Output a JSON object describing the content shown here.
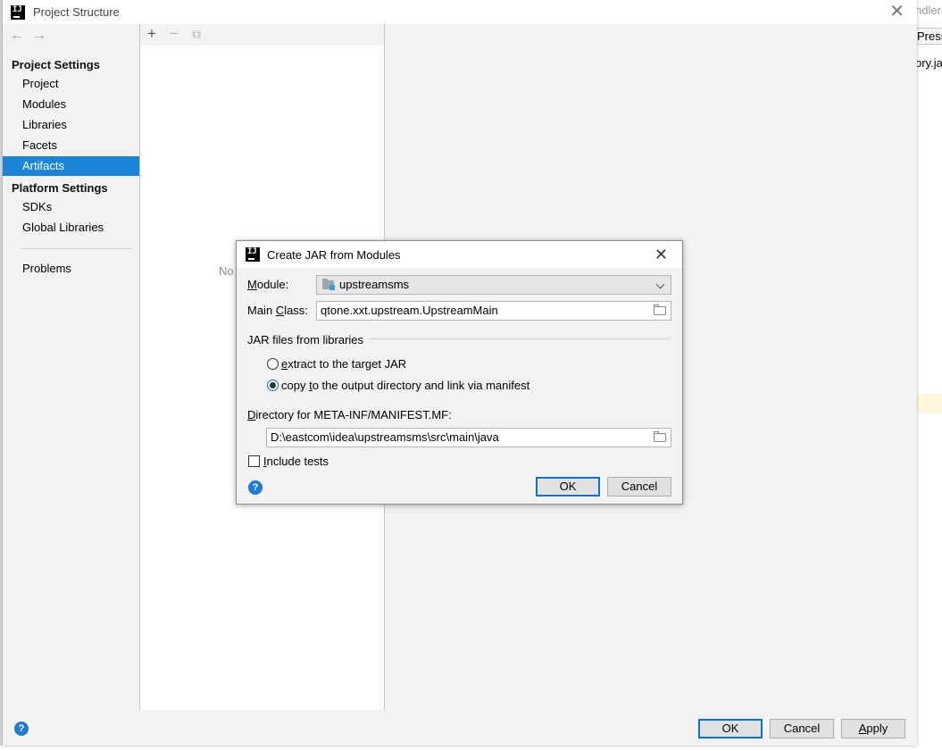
{
  "background_ide": {
    "fragment_top": "ndler",
    "fragment_press": "Press",
    "fragment_tab": "ory.ja"
  },
  "project_structure": {
    "title": "Project Structure",
    "toolbar": {
      "add": "+",
      "remove": "−",
      "copy": "⧉"
    },
    "sidebar": {
      "project_settings_header": "Project Settings",
      "project_settings_items": [
        {
          "label": "Project"
        },
        {
          "label": "Modules"
        },
        {
          "label": "Libraries"
        },
        {
          "label": "Facets"
        },
        {
          "label": "Artifacts",
          "selected": true
        }
      ],
      "platform_settings_header": "Platform Settings",
      "platform_settings_items": [
        {
          "label": "SDKs"
        },
        {
          "label": "Global Libraries"
        }
      ],
      "problems": "Problems"
    },
    "middle_empty_text": "No",
    "buttons": {
      "ok": "OK",
      "cancel": "Cancel",
      "apply": "Apply"
    },
    "help_icon": "?"
  },
  "create_jar_dialog": {
    "title": "Create JAR from Modules",
    "module_label": "Module:",
    "module_value": "upstreamsms",
    "main_class_label": "Main Class:",
    "main_class_value": "qtone.xxt.upstream.UpstreamMain",
    "jar_files_group": "JAR files from libraries",
    "radio_extract": "extract to the target JAR",
    "radio_copy": "copy to the output directory and link via manifest",
    "radio_selected": "copy",
    "manifest_dir_label": "Directory for META-INF/MANIFEST.MF:",
    "manifest_dir_value": "D:\\eastcom\\idea\\upstreamsms\\src\\main\\java",
    "include_tests_label": "Include tests",
    "include_tests_checked": false,
    "ok": "OK",
    "cancel": "Cancel",
    "help_icon": "?"
  },
  "colors": {
    "selection": "#1b84d6",
    "default_button_border": "#0b73d4",
    "help_icon": "#1f7bd6"
  }
}
